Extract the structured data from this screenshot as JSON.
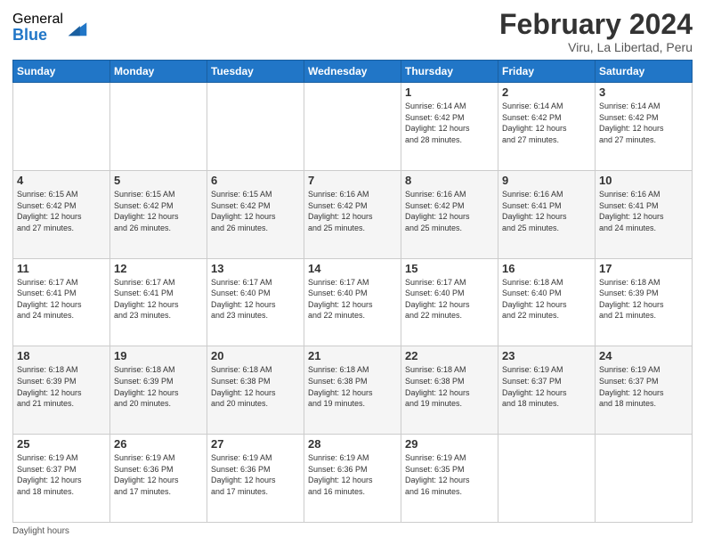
{
  "header": {
    "logo_general": "General",
    "logo_blue": "Blue",
    "title": "February 2024",
    "location": "Viru, La Libertad, Peru"
  },
  "days_of_week": [
    "Sunday",
    "Monday",
    "Tuesday",
    "Wednesday",
    "Thursday",
    "Friday",
    "Saturday"
  ],
  "weeks": [
    [
      {
        "day": "",
        "info": ""
      },
      {
        "day": "",
        "info": ""
      },
      {
        "day": "",
        "info": ""
      },
      {
        "day": "",
        "info": ""
      },
      {
        "day": "1",
        "info": "Sunrise: 6:14 AM\nSunset: 6:42 PM\nDaylight: 12 hours\nand 28 minutes."
      },
      {
        "day": "2",
        "info": "Sunrise: 6:14 AM\nSunset: 6:42 PM\nDaylight: 12 hours\nand 27 minutes."
      },
      {
        "day": "3",
        "info": "Sunrise: 6:14 AM\nSunset: 6:42 PM\nDaylight: 12 hours\nand 27 minutes."
      }
    ],
    [
      {
        "day": "4",
        "info": "Sunrise: 6:15 AM\nSunset: 6:42 PM\nDaylight: 12 hours\nand 27 minutes."
      },
      {
        "day": "5",
        "info": "Sunrise: 6:15 AM\nSunset: 6:42 PM\nDaylight: 12 hours\nand 26 minutes."
      },
      {
        "day": "6",
        "info": "Sunrise: 6:15 AM\nSunset: 6:42 PM\nDaylight: 12 hours\nand 26 minutes."
      },
      {
        "day": "7",
        "info": "Sunrise: 6:16 AM\nSunset: 6:42 PM\nDaylight: 12 hours\nand 25 minutes."
      },
      {
        "day": "8",
        "info": "Sunrise: 6:16 AM\nSunset: 6:42 PM\nDaylight: 12 hours\nand 25 minutes."
      },
      {
        "day": "9",
        "info": "Sunrise: 6:16 AM\nSunset: 6:41 PM\nDaylight: 12 hours\nand 25 minutes."
      },
      {
        "day": "10",
        "info": "Sunrise: 6:16 AM\nSunset: 6:41 PM\nDaylight: 12 hours\nand 24 minutes."
      }
    ],
    [
      {
        "day": "11",
        "info": "Sunrise: 6:17 AM\nSunset: 6:41 PM\nDaylight: 12 hours\nand 24 minutes."
      },
      {
        "day": "12",
        "info": "Sunrise: 6:17 AM\nSunset: 6:41 PM\nDaylight: 12 hours\nand 23 minutes."
      },
      {
        "day": "13",
        "info": "Sunrise: 6:17 AM\nSunset: 6:40 PM\nDaylight: 12 hours\nand 23 minutes."
      },
      {
        "day": "14",
        "info": "Sunrise: 6:17 AM\nSunset: 6:40 PM\nDaylight: 12 hours\nand 22 minutes."
      },
      {
        "day": "15",
        "info": "Sunrise: 6:17 AM\nSunset: 6:40 PM\nDaylight: 12 hours\nand 22 minutes."
      },
      {
        "day": "16",
        "info": "Sunrise: 6:18 AM\nSunset: 6:40 PM\nDaylight: 12 hours\nand 22 minutes."
      },
      {
        "day": "17",
        "info": "Sunrise: 6:18 AM\nSunset: 6:39 PM\nDaylight: 12 hours\nand 21 minutes."
      }
    ],
    [
      {
        "day": "18",
        "info": "Sunrise: 6:18 AM\nSunset: 6:39 PM\nDaylight: 12 hours\nand 21 minutes."
      },
      {
        "day": "19",
        "info": "Sunrise: 6:18 AM\nSunset: 6:39 PM\nDaylight: 12 hours\nand 20 minutes."
      },
      {
        "day": "20",
        "info": "Sunrise: 6:18 AM\nSunset: 6:38 PM\nDaylight: 12 hours\nand 20 minutes."
      },
      {
        "day": "21",
        "info": "Sunrise: 6:18 AM\nSunset: 6:38 PM\nDaylight: 12 hours\nand 19 minutes."
      },
      {
        "day": "22",
        "info": "Sunrise: 6:18 AM\nSunset: 6:38 PM\nDaylight: 12 hours\nand 19 minutes."
      },
      {
        "day": "23",
        "info": "Sunrise: 6:19 AM\nSunset: 6:37 PM\nDaylight: 12 hours\nand 18 minutes."
      },
      {
        "day": "24",
        "info": "Sunrise: 6:19 AM\nSunset: 6:37 PM\nDaylight: 12 hours\nand 18 minutes."
      }
    ],
    [
      {
        "day": "25",
        "info": "Sunrise: 6:19 AM\nSunset: 6:37 PM\nDaylight: 12 hours\nand 18 minutes."
      },
      {
        "day": "26",
        "info": "Sunrise: 6:19 AM\nSunset: 6:36 PM\nDaylight: 12 hours\nand 17 minutes."
      },
      {
        "day": "27",
        "info": "Sunrise: 6:19 AM\nSunset: 6:36 PM\nDaylight: 12 hours\nand 17 minutes."
      },
      {
        "day": "28",
        "info": "Sunrise: 6:19 AM\nSunset: 6:36 PM\nDaylight: 12 hours\nand 16 minutes."
      },
      {
        "day": "29",
        "info": "Sunrise: 6:19 AM\nSunset: 6:35 PM\nDaylight: 12 hours\nand 16 minutes."
      },
      {
        "day": "",
        "info": ""
      },
      {
        "day": "",
        "info": ""
      }
    ]
  ],
  "footer": {
    "daylight_label": "Daylight hours"
  }
}
